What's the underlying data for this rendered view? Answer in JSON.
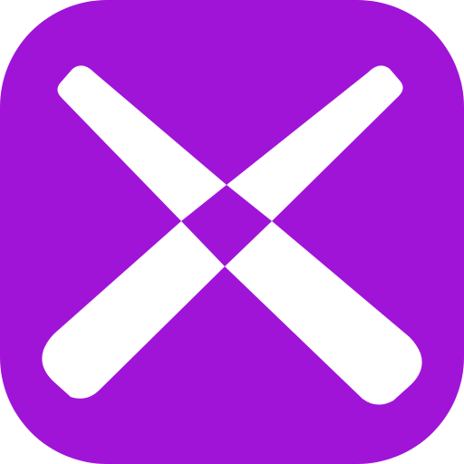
{
  "icon": {
    "name": "x-cross-app-icon",
    "background_color": "#a014d8",
    "foreground_color": "#ffffff",
    "page_background": "#ffffff"
  }
}
